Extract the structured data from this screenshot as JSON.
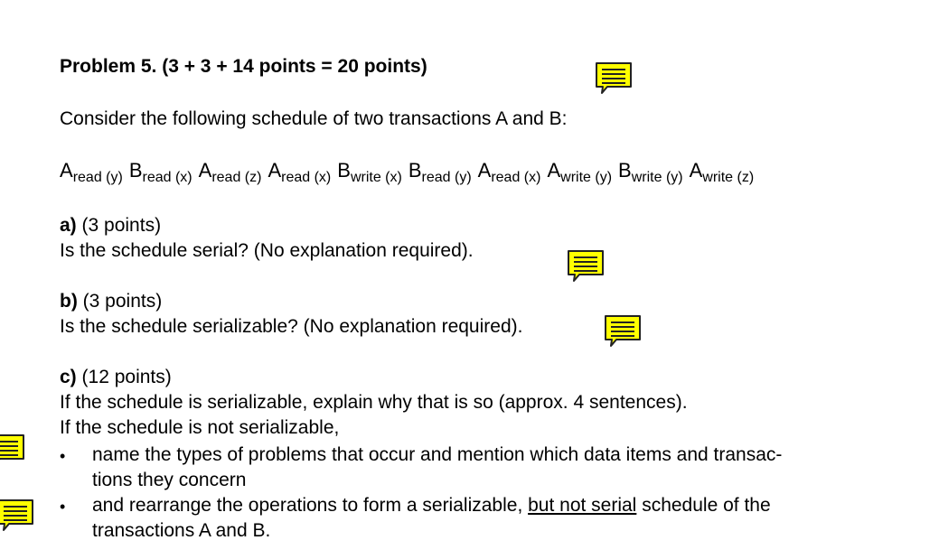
{
  "problem": {
    "title": "Problem 5. (3 + 3 + 14 points = 20 points)",
    "intro": "Consider the following schedule of two transactions A and B:",
    "schedule": [
      {
        "t": "A",
        "op": "read (y)"
      },
      {
        "t": "B",
        "op": "read (x)"
      },
      {
        "t": "A",
        "op": "read (z)"
      },
      {
        "t": "A",
        "op": "read (x)"
      },
      {
        "t": "B",
        "op": "write (x)"
      },
      {
        "t": "B",
        "op": "read (y)"
      },
      {
        "t": "A",
        "op": "read (x)"
      },
      {
        "t": "A",
        "op": "write (y)"
      },
      {
        "t": "B",
        "op": "write (y)"
      },
      {
        "t": "A",
        "op": "write (z)"
      }
    ]
  },
  "part_a": {
    "label": "a)",
    "points": " (3 points)",
    "question": "Is the schedule serial? (No explanation required)."
  },
  "part_b": {
    "label": "b)",
    "points": " (3 points)",
    "question": "Is the schedule serializable? (No explanation required)."
  },
  "part_c": {
    "label": "c)",
    "points": " (12 points)",
    "line1": "If the schedule is serializable, explain why that is so (approx. 4 sentences).",
    "line2": "If the schedule is not serializable,",
    "bullet_char": "•",
    "bullet1_l1": "name the types of problems that occur and mention which data items and transac-",
    "bullet1_l2": "tions they concern",
    "bullet2_pre": "and rearrange the operations to form a serializable, ",
    "bullet2_underlined": "but not serial",
    "bullet2_post": " schedule of the",
    "bullet2_l2": "transactions A and B."
  },
  "icons": {
    "note_fill": "#ffff00",
    "note_stroke": "#222222",
    "note_name": "comment-note-icon"
  }
}
